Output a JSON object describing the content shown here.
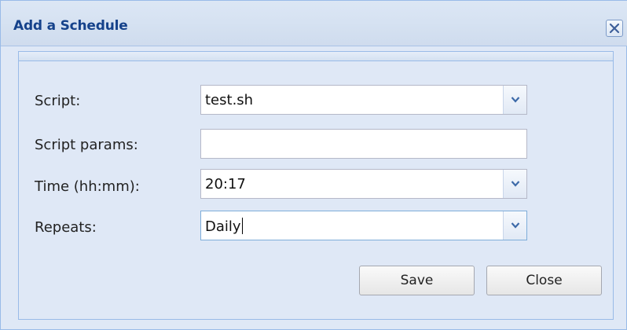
{
  "dialog": {
    "title": "Add a Schedule"
  },
  "form": {
    "script": {
      "label": "Script:",
      "value": "test.sh"
    },
    "params": {
      "label": "Script params:",
      "value": ""
    },
    "time": {
      "label": "Time (hh:mm):",
      "value": "20:17"
    },
    "repeats": {
      "label": "Repeats:",
      "value": "Daily"
    }
  },
  "buttons": {
    "save": "Save",
    "close": "Close"
  },
  "icons": {
    "close": "close-icon",
    "dropdown": "chevron-down-icon"
  },
  "colors": {
    "title": "#15428b",
    "panel": "#dfe8f6",
    "border": "#99bbe8"
  }
}
